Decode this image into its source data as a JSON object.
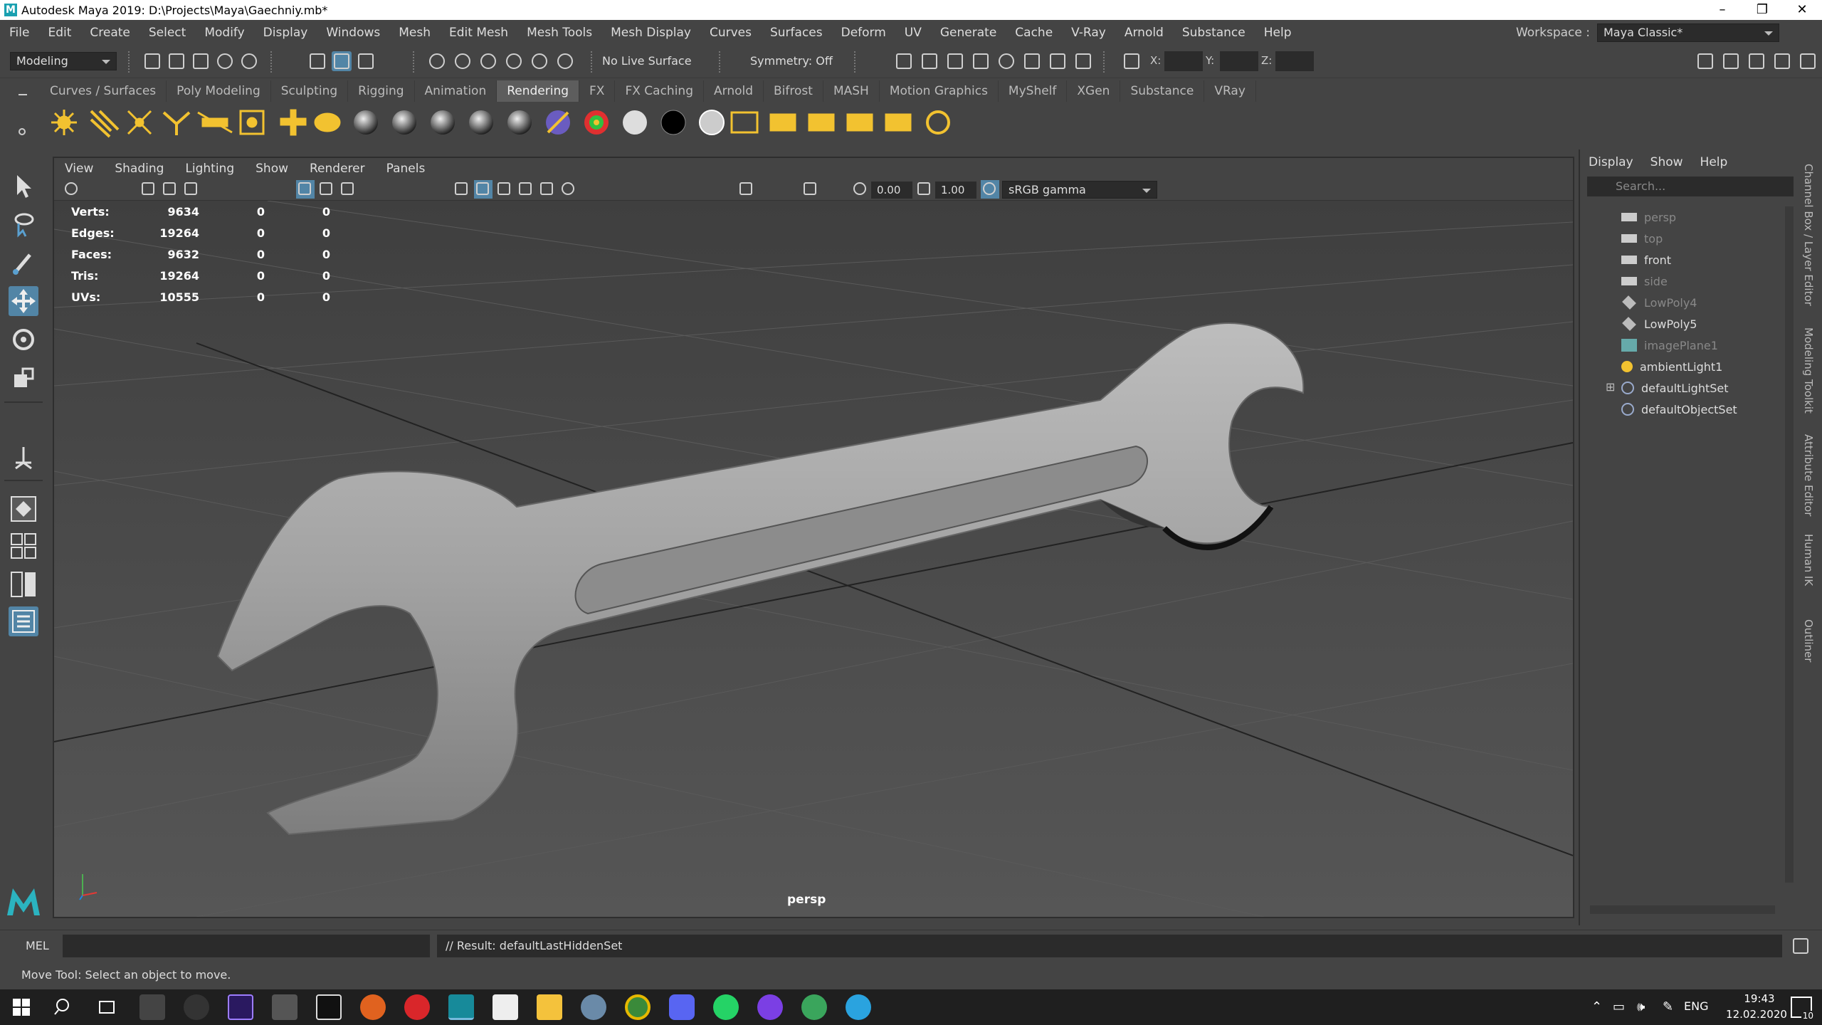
{
  "window": {
    "title": "Autodesk Maya 2019: D:\\Projects\\Maya\\Gaechniy.mb*"
  },
  "menubar": [
    "File",
    "Edit",
    "Create",
    "Select",
    "Modify",
    "Display",
    "Windows",
    "Mesh",
    "Edit Mesh",
    "Mesh Tools",
    "Mesh Display",
    "Curves",
    "Surfaces",
    "Deform",
    "UV",
    "Generate",
    "Cache",
    "V-Ray",
    "Arnold",
    "Substance",
    "Help"
  ],
  "workspace": {
    "label": "Workspace :",
    "value": "Maya Classic*"
  },
  "status": {
    "mode": "Modeling",
    "live_surface": "No Live Surface",
    "symmetry": "Symmetry: Off",
    "x_label": "X:",
    "y_label": "Y:",
    "z_label": "Z:"
  },
  "shelf_tabs": [
    "Curves / Surfaces",
    "Poly Modeling",
    "Sculpting",
    "Rigging",
    "Animation",
    "Rendering",
    "FX",
    "FX Caching",
    "Arnold",
    "Bifrost",
    "MASH",
    "Motion Graphics",
    "MyShelf",
    "XGen",
    "Substance",
    "VRay"
  ],
  "active_shelf_tab": "Rendering",
  "viewport": {
    "menu": [
      "View",
      "Shading",
      "Lighting",
      "Show",
      "Renderer",
      "Panels"
    ],
    "exposure": "0.00",
    "gamma": "1.00",
    "color_space": "sRGB gamma",
    "camera": "persp",
    "hud": [
      {
        "label": "Verts:",
        "a": "9634",
        "b": "0",
        "c": "0"
      },
      {
        "label": "Edges:",
        "a": "19264",
        "b": "0",
        "c": "0"
      },
      {
        "label": "Faces:",
        "a": "9632",
        "b": "0",
        "c": "0"
      },
      {
        "label": "Tris:",
        "a": "19264",
        "b": "0",
        "c": "0"
      },
      {
        "label": "UVs:",
        "a": "10555",
        "b": "0",
        "c": "0"
      }
    ]
  },
  "outliner": {
    "menu": [
      "Display",
      "Show",
      "Help"
    ],
    "search_placeholder": "Search...",
    "items": [
      {
        "name": "persp",
        "dim": true
      },
      {
        "name": "top",
        "dim": true
      },
      {
        "name": "front",
        "dim": false
      },
      {
        "name": "side",
        "dim": true
      },
      {
        "name": "LowPoly4",
        "dim": true
      },
      {
        "name": "LowPoly5",
        "dim": false
      },
      {
        "name": "imagePlane1",
        "dim": true
      },
      {
        "name": "ambientLight1",
        "dim": false
      },
      {
        "name": "defaultLightSet",
        "dim": false
      },
      {
        "name": "defaultObjectSet",
        "dim": false
      }
    ]
  },
  "side_tabs": [
    "Channel Box / Layer Editor",
    "Modeling Toolkit",
    "Attribute Editor",
    "Human IK",
    "Outliner"
  ],
  "command": {
    "lang": "MEL",
    "result": "// Result: defaultLastHiddenSet"
  },
  "help_line": "Move Tool: Select an object to move.",
  "taskbar": {
    "lang": "ENG",
    "time": "19:43",
    "date": "12.02.2020",
    "notifications": "10"
  }
}
